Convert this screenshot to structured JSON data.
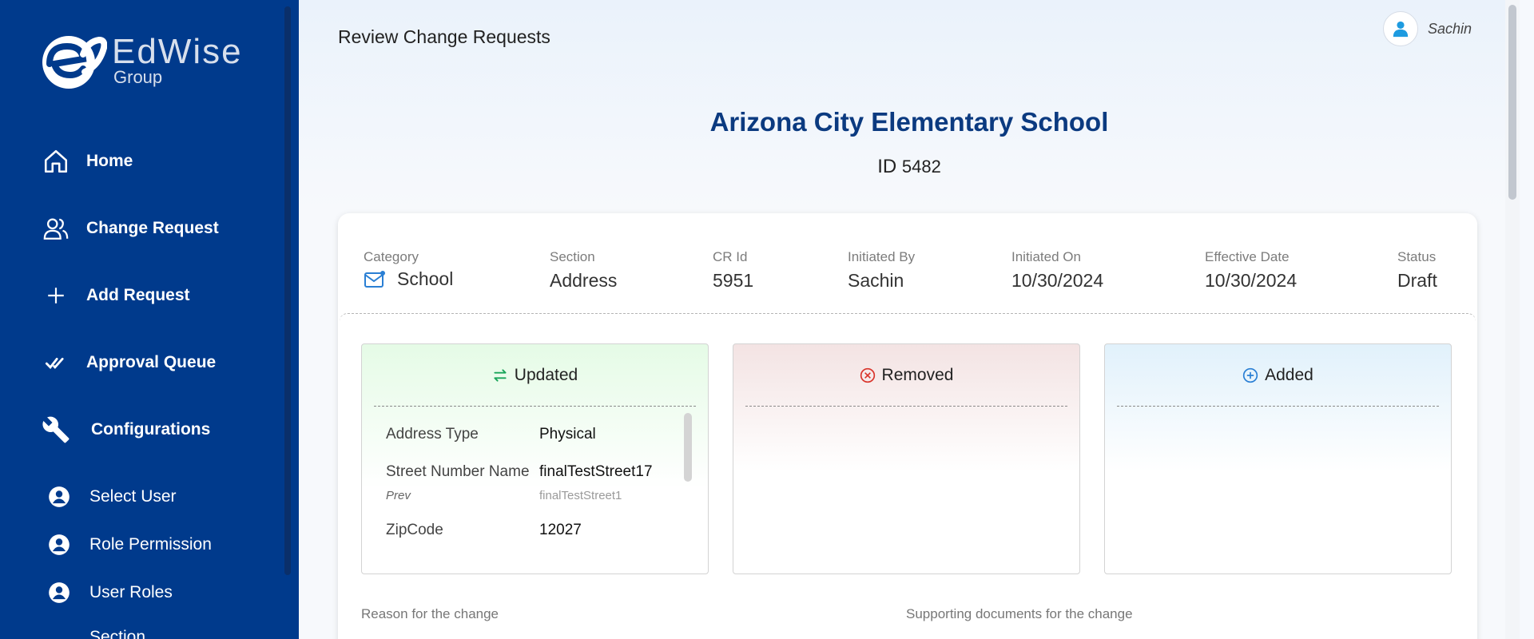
{
  "sidebar": {
    "logo": {
      "word": "EdWise",
      "sub": "Group"
    },
    "nav": [
      {
        "label": "Home",
        "icon": "home-icon"
      },
      {
        "label": "Change Request",
        "icon": "users-icon"
      },
      {
        "label": "Add Request",
        "icon": "plus-icon"
      },
      {
        "label": "Approval Queue",
        "icon": "double-check-icon"
      },
      {
        "label": "Configurations",
        "icon": "wrench-icon"
      }
    ],
    "sub_items": [
      {
        "label": "Select User",
        "icon": "account-circle-icon"
      },
      {
        "label": "Role Permission",
        "icon": "account-circle-icon"
      },
      {
        "label": "User Roles",
        "icon": "account-circle-icon"
      },
      {
        "label": "Section",
        "icon": "account-circle-icon"
      }
    ]
  },
  "header": {
    "title": "Review Change Requests",
    "user_name": "Sachin"
  },
  "school": {
    "name": "Arizona City Elementary School",
    "id_label": "ID",
    "id": "5482"
  },
  "meta": {
    "category_label": "Category",
    "category_value": "School",
    "section_label": "Section",
    "section_value": "Address",
    "crid_label": "CR Id",
    "crid_value": "5951",
    "initiated_by_label": "Initiated By",
    "initiated_by_value": "Sachin",
    "initiated_on_label": "Initiated On",
    "initiated_on_value": "10/30/2024",
    "effective_date_label": "Effective Date",
    "effective_date_value": "10/30/2024",
    "status_label": "Status",
    "status_value": "Draft"
  },
  "panels": {
    "updated": {
      "title": "Updated",
      "rows": [
        {
          "key": "Address Type",
          "value": "Physical"
        },
        {
          "key": "Street Number Name",
          "value": "finalTestStreet17"
        },
        {
          "key": "Prev",
          "value": "finalTestStreet1"
        },
        {
          "key": "ZipCode",
          "value": "12027"
        }
      ]
    },
    "removed": {
      "title": "Removed"
    },
    "added": {
      "title": "Added"
    }
  },
  "footer": {
    "reason_label": "Reason for the change",
    "documents_label": "Supporting documents for the change"
  },
  "colors": {
    "sidebar_bg": "#003a8c",
    "title_blue": "#0b3a80",
    "updated_green": "#19a55a",
    "removed_red": "#d9342b",
    "added_blue": "#2a7fd4"
  }
}
